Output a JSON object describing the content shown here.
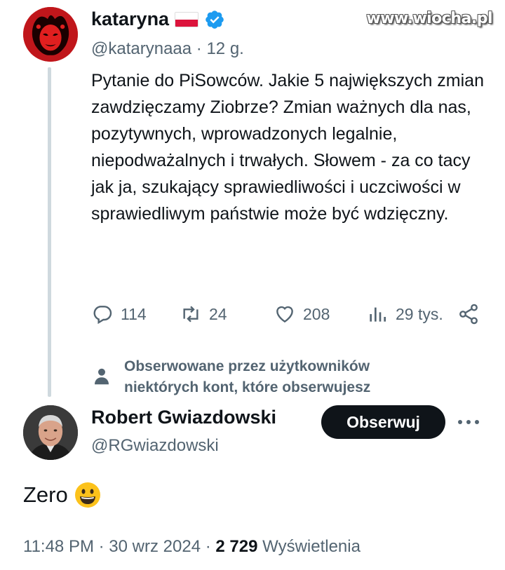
{
  "watermark": "www.wiocha.pl",
  "tweet": {
    "author_name": "kataryna",
    "handle": "@katarynaaa",
    "separator": "·",
    "time_ago": "12 g.",
    "text": "Pytanie do PiSowców. Jakie 5 największych zmian zawdzięczamy Ziobrze? Zmian ważnych dla nas, pozytywnych, wprowadzonych legalnie, niepodważalnych i trwałych. Słowem - za co tacy jak ja, szukający sprawiedliwości i uczciwości w sprawiedliwym państwie może być wdzięczny.",
    "reply_count": "114",
    "retweet_count": "24",
    "like_count": "208",
    "view_count": "29 tys.",
    "icons": [
      "flag-poland-icon",
      "verified-badge-icon",
      "reply-icon",
      "retweet-icon",
      "like-icon",
      "views-icon",
      "share-icon"
    ]
  },
  "followed_note": {
    "line1": "Obserwowane przez użytkowników",
    "line2": "niektórych kont, które obserwujesz"
  },
  "reply": {
    "author_name": "Robert Gwiazdowski",
    "handle": "@RGwiazdowski",
    "follow_label": "Obserwuj",
    "text": "Zero",
    "emoji": "grinning-face-emoji",
    "time": "11:48 PM",
    "separator": "·",
    "date": "30 wrz 2024",
    "views_count": "2 729",
    "views_label": "Wyświetlenia"
  },
  "colors": {
    "text": "#0f1419",
    "secondary": "#536471",
    "verified": "#1d9bf0",
    "thread_line": "#cfd9de",
    "button_bg": "#0f1419"
  }
}
